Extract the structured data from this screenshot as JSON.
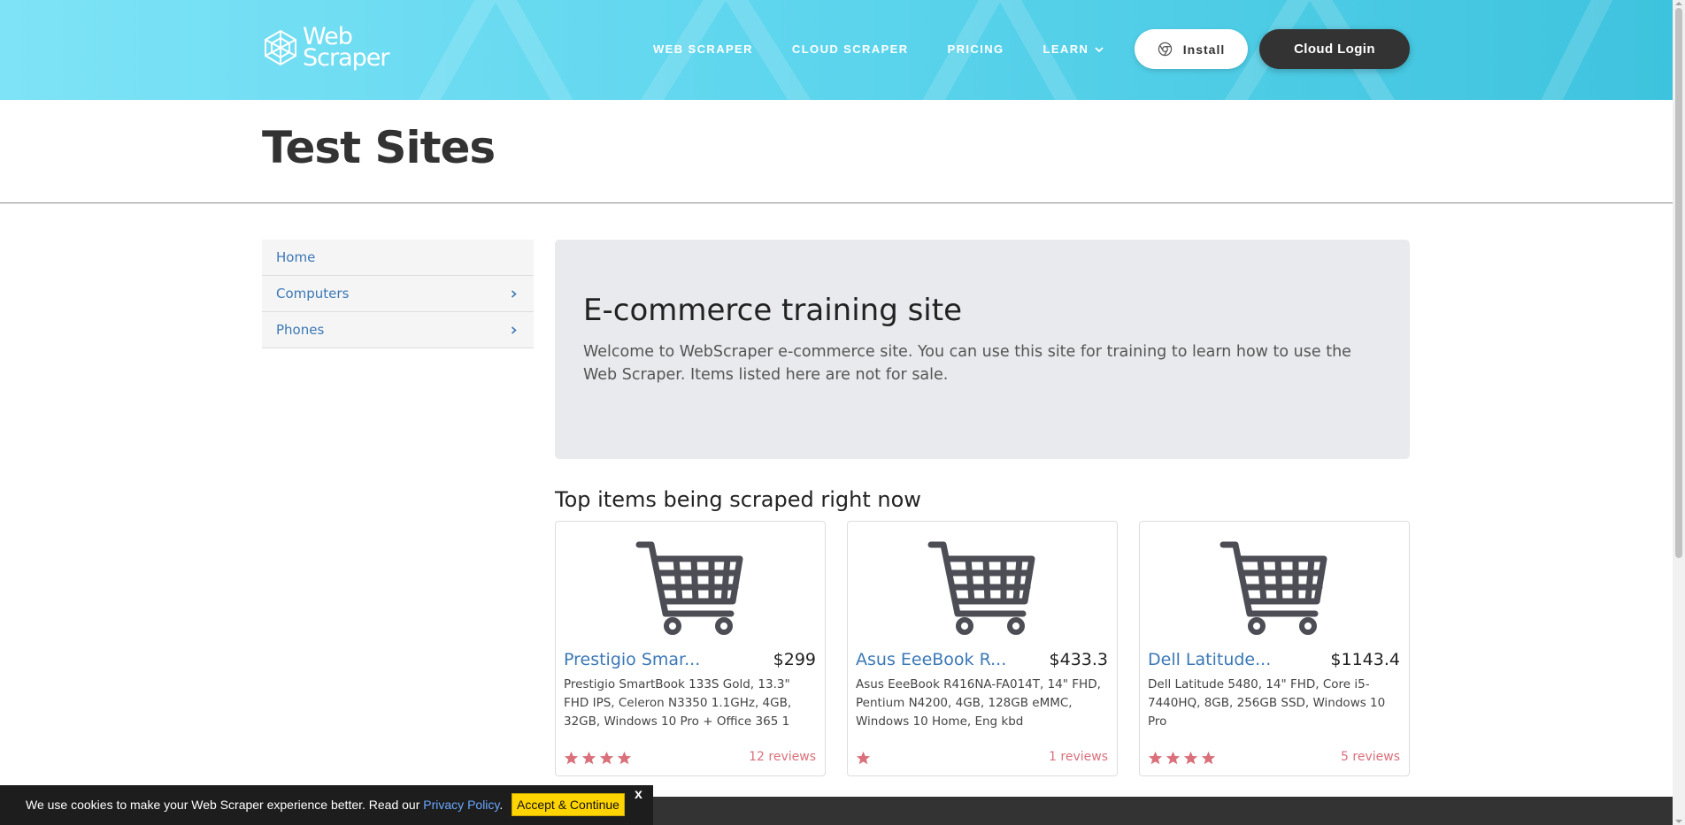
{
  "header": {
    "logo": {
      "line1": "Web",
      "line2": "Scraper"
    },
    "nav": [
      {
        "label": "WEB SCRAPER"
      },
      {
        "label": "CLOUD SCRAPER"
      },
      {
        "label": "PRICING"
      },
      {
        "label": "LEARN"
      }
    ],
    "install_label": "Install",
    "cloud_login_label": "Cloud Login"
  },
  "page": {
    "title": "Test Sites"
  },
  "sidebar": {
    "items": [
      {
        "label": "Home",
        "icon": null
      },
      {
        "label": "Computers",
        "icon": "chevron-right-icon"
      },
      {
        "label": "Phones",
        "icon": "chevron-right-icon"
      }
    ]
  },
  "jumbotron": {
    "heading": "E-commerce training site",
    "text": "Welcome to WebScraper e-commerce site. You can use this site for training to learn how to use the Web Scraper. Items listed here are not for sale."
  },
  "top_items": {
    "heading": "Top items being scraped right now",
    "products": [
      {
        "title": "Prestigio Smar...",
        "price": "$299",
        "description": "Prestigio SmartBook 133S Gold, 13.3\" FHD IPS, Celeron N3350 1.1GHz, 4GB, 32GB, Windows 10 Pro + Office 365 1",
        "rating": 4,
        "reviews": "12 reviews"
      },
      {
        "title": "Asus EeeBook R...",
        "price": "$433.3",
        "description": "Asus EeeBook R416NA-FA014T, 14\" FHD, Pentium N4200, 4GB, 128GB eMMC, Windows 10 Home, Eng kbd",
        "rating": 1,
        "reviews": "1 reviews"
      },
      {
        "title": "Dell Latitude...",
        "price": "$1143.4",
        "description": "Dell Latitude 5480, 14\" FHD, Core i5-7440HQ, 8GB, 256GB SSD, Windows 10 Pro",
        "rating": 4,
        "reviews": "5 reviews"
      }
    ]
  },
  "cookie": {
    "text": "We use cookies to make your Web Scraper experience better. Read our ",
    "link": "Privacy Policy",
    "after": ".",
    "accept": "Accept & Continue",
    "close": "x"
  },
  "colors": {
    "accent": "#3b78b6",
    "star": "#d9707b",
    "header_start": "#7ee3f6",
    "header_end": "#3ec3de"
  }
}
